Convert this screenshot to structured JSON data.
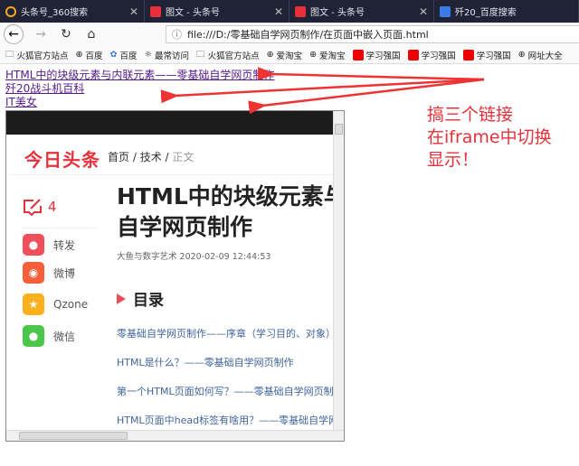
{
  "tabs": [
    {
      "title": "头条号_360搜索",
      "icon": "360-search-icon"
    },
    {
      "title": "图文 - 头条号",
      "icon": "toutiao-icon"
    },
    {
      "title": "图文 - 头条号",
      "icon": "toutiao-icon"
    },
    {
      "title": "歼20_百度搜索",
      "icon": "baidu-paw-icon"
    }
  ],
  "url": "file:///D:/零基础自学网页制作/在页面中嵌入页面.html",
  "bookmarks": [
    "火狐官方站点",
    "百度",
    "百度",
    "最常访问",
    "火狐官方站点",
    "爱淘宝",
    "爱淘宝",
    "学习强国",
    "学习强国",
    "学习强国",
    "网址大全"
  ],
  "links": [
    "HTML中的块级元素与内联元素——零基础自学网页制作",
    "歼20战斗机百科",
    "IT美女"
  ],
  "iframe": {
    "logo": "今日头条",
    "crumb": {
      "home": "首页",
      "sep": " / ",
      "tech": "技术",
      "current": "正文"
    },
    "comment_count": "4",
    "share": [
      "转发",
      "微博",
      "Qzone",
      "微信"
    ],
    "title_lines": [
      "HTML中的块级元素与内联元素——零基础",
      "自学网页制作"
    ],
    "meta": "大鱼与数字艺术  2020-02-09 12:44:53",
    "toc_heading": "目录",
    "toc": [
      "零基础自学网页制作——序章（学习目的、对象）",
      "HTML是什么？——零基础自学网页制作",
      "第一个HTML页面如何写？——零基础自学网页制作",
      "HTML页面中head标签有啥用？——零基础自学网页制作"
    ]
  },
  "annotation": [
    "搞三个链接",
    "在iframe中切换",
    "显示！"
  ],
  "colors": {
    "accent": "#e8303a",
    "link": "#551a8b"
  }
}
